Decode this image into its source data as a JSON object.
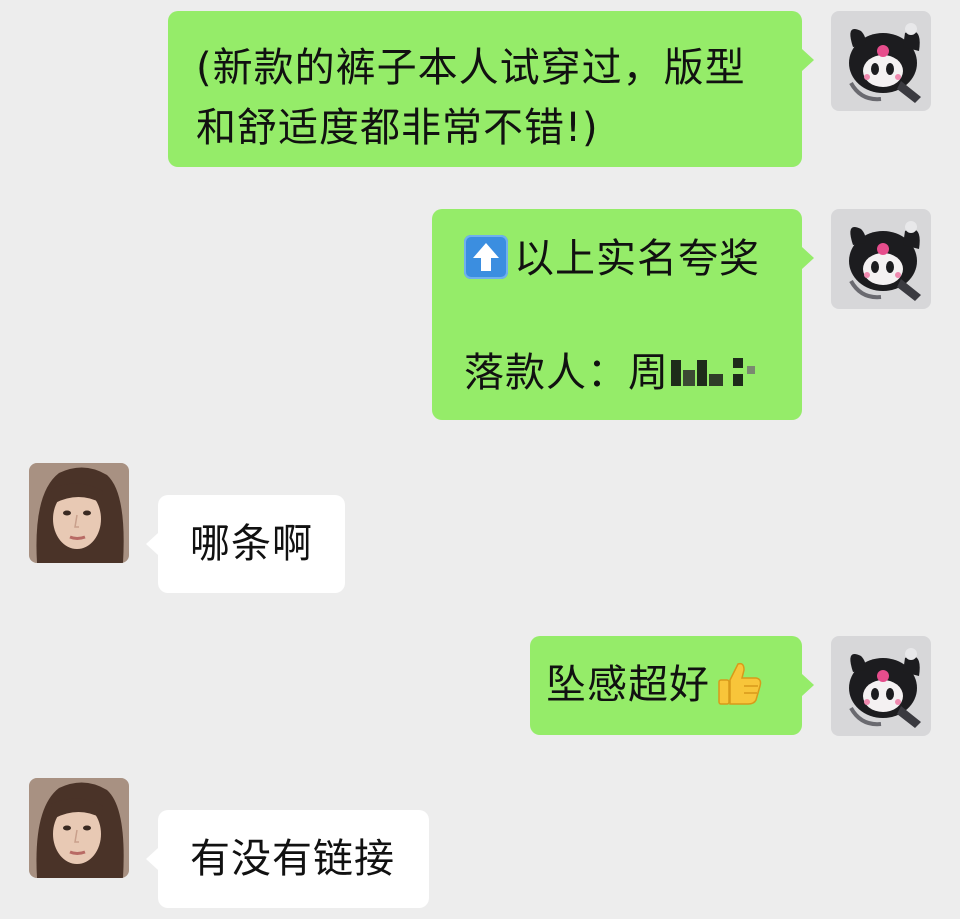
{
  "colors": {
    "background": "#ededed",
    "outgoing_bubble": "#95ec69",
    "incoming_bubble": "#ffffff"
  },
  "messages": [
    {
      "direction": "outgoing",
      "lines": [
        "(新款的裤子本人试穿过，版型",
        "和舒适度都非常不错!)"
      ],
      "avatar": "kuromi-plush-avatar"
    },
    {
      "direction": "outgoing",
      "line1_icon": "up-arrow-icon",
      "line1_text": "以上实名夸奖",
      "line2_text": "落款人：周",
      "line2_redacted": true,
      "avatar": "kuromi-plush-avatar"
    },
    {
      "direction": "incoming",
      "text": "哪条啊",
      "avatar": "woman-portrait-avatar"
    },
    {
      "direction": "outgoing",
      "text": "坠感超好",
      "trailing_icon": "thumbs-up-icon",
      "avatar": "kuromi-plush-avatar"
    },
    {
      "direction": "incoming",
      "text": "有没有链接",
      "avatar": "woman-portrait-avatar"
    }
  ]
}
